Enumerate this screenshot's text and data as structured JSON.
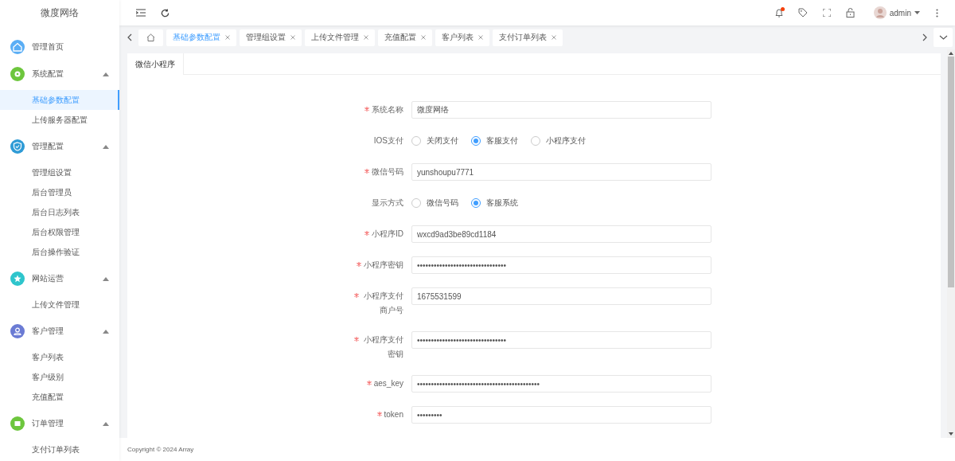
{
  "brand": "微度网络",
  "sidebar": {
    "items": [
      {
        "label": "管理首页",
        "color": "#5aaef5"
      },
      {
        "label": "系统配置",
        "color": "#6dc63d",
        "expanded": true,
        "children": [
          {
            "label": "基础参数配置",
            "selected": true
          },
          {
            "label": "上传服务器配置",
            "selected": false
          }
        ]
      },
      {
        "label": "管理配置",
        "color": "#2f9bd6",
        "expanded": true,
        "children": [
          {
            "label": "管理组设置",
            "selected": false
          },
          {
            "label": "后台管理员",
            "selected": false
          },
          {
            "label": "后台日志列表",
            "selected": false
          },
          {
            "label": "后台权限管理",
            "selected": false
          },
          {
            "label": "后台操作验证",
            "selected": false
          }
        ]
      },
      {
        "label": "网站运营",
        "color": "#2ec5cc",
        "expanded": true,
        "children": [
          {
            "label": "上传文件管理",
            "selected": false
          }
        ]
      },
      {
        "label": "客户管理",
        "color": "#6b7bd4",
        "expanded": true,
        "children": [
          {
            "label": "客户列表",
            "selected": false
          },
          {
            "label": "客户级别",
            "selected": false
          },
          {
            "label": "充值配置",
            "selected": false
          }
        ]
      },
      {
        "label": "订单管理",
        "color": "#6dc63d",
        "expanded": true,
        "children": [
          {
            "label": "支付订单列表",
            "selected": false
          }
        ]
      }
    ]
  },
  "header": {
    "user": "admin",
    "has_notification": true
  },
  "tabs": [
    {
      "label": "基础参数配置",
      "selected": true
    },
    {
      "label": "管理组设置",
      "selected": false
    },
    {
      "label": "上传文件管理",
      "selected": false
    },
    {
      "label": "充值配置",
      "selected": false
    },
    {
      "label": "客户列表",
      "selected": false
    },
    {
      "label": "支付订单列表",
      "selected": false
    }
  ],
  "content_tabs": [
    {
      "label": "微信小程序",
      "selected": true
    }
  ],
  "form": [
    {
      "kind": "text",
      "label": "系统名称",
      "required": true,
      "value": "微度网络"
    },
    {
      "kind": "radio",
      "label": "IOS支付",
      "options": [
        {
          "label": "关闭支付",
          "selected": false
        },
        {
          "label": "客服支付",
          "selected": true
        },
        {
          "label": "小程序支付",
          "selected": false
        }
      ]
    },
    {
      "kind": "text",
      "label": "微信号码",
      "required": true,
      "value": "yunshoupu7771"
    },
    {
      "kind": "radio",
      "label": "显示方式",
      "options": [
        {
          "label": "微信号码",
          "selected": false
        },
        {
          "label": "客服系统",
          "selected": true
        }
      ]
    },
    {
      "kind": "text",
      "label": "小程序ID",
      "required": true,
      "value": "wxcd9ad3be89cd1184"
    },
    {
      "kind": "text",
      "label": "小程序密钥",
      "required": true,
      "value": "••••••••••••••••••••••••••••••••"
    },
    {
      "kind": "text",
      "label": "小程序支付商户号",
      "required": true,
      "value": "1675531599"
    },
    {
      "kind": "text",
      "label": "小程序支付密钥",
      "required": true,
      "value": "••••••••••••••••••••••••••••••••"
    },
    {
      "kind": "text",
      "label": "aes_key",
      "required": true,
      "value": "••••••••••••••••••••••••••••••••••••••••••••"
    },
    {
      "kind": "text",
      "label": "token",
      "required": true,
      "value": "•••••••••"
    }
  ],
  "footer": "Copyright © 2024 Array"
}
